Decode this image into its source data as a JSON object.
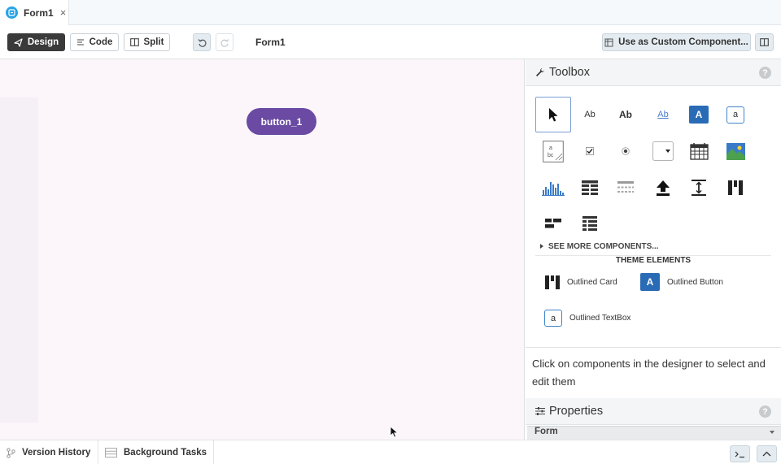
{
  "tab": {
    "label": "Form1",
    "close": "×"
  },
  "toolbar": {
    "design_label": "Design",
    "code_label": "Code",
    "split_label": "Split",
    "form_title": "Form1",
    "custom_label": "Use as Custom Component..."
  },
  "canvas": {
    "button_label": "button_1"
  },
  "toolbox": {
    "title": "Toolbox",
    "help": "?",
    "tools": [
      {
        "name": "pointer",
        "text": ""
      },
      {
        "name": "label",
        "text": "Ab"
      },
      {
        "name": "rich-text",
        "text": "Ab"
      },
      {
        "name": "link",
        "text": "Ab"
      },
      {
        "name": "button",
        "text": "A"
      },
      {
        "name": "textbox",
        "text": "a"
      },
      {
        "name": "textarea",
        "text": ""
      },
      {
        "name": "checkbox",
        "text": ""
      },
      {
        "name": "radio",
        "text": ""
      },
      {
        "name": "dropdown",
        "text": ""
      },
      {
        "name": "date-picker",
        "text": ""
      },
      {
        "name": "image",
        "text": ""
      },
      {
        "name": "plot",
        "text": ""
      },
      {
        "name": "data-grid",
        "text": ""
      },
      {
        "name": "repeating-panel",
        "text": ""
      },
      {
        "name": "file-loader",
        "text": ""
      },
      {
        "name": "spacer",
        "text": ""
      },
      {
        "name": "column-panel",
        "text": ""
      },
      {
        "name": "flow-panel",
        "text": ""
      },
      {
        "name": "linear-panel",
        "text": ""
      }
    ],
    "see_more": "SEE MORE COMPONENTS...",
    "theme_title": "THEME ELEMENTS",
    "theme_items": [
      "Outlined Card",
      "Outlined Button",
      "Outlined TextBox"
    ]
  },
  "hint": "Click on components in the designer to select and edit them",
  "properties": {
    "title": "Properties",
    "help": "?",
    "section": "Form"
  },
  "bottom": {
    "version_history": "Version History",
    "background_tasks": "Background Tasks"
  },
  "colors": {
    "primary_button": "#6a4aa3",
    "accent_blue": "#27a3e6",
    "design_button": "#3a3a3a"
  }
}
